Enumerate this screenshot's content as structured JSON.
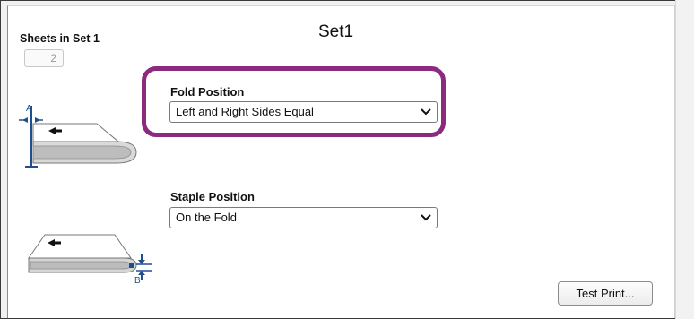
{
  "header": {
    "set_title": "Set1"
  },
  "sheets": {
    "label": "Sheets in Set 1",
    "value": "2"
  },
  "fold": {
    "label": "Fold Position",
    "selected": "Left and Right Sides Equal"
  },
  "staple": {
    "label": "Staple Position",
    "selected": "On the Fold"
  },
  "illustrations": {
    "fold_marker": "A",
    "staple_marker": "B"
  },
  "actions": {
    "test_print": "Test Print..."
  },
  "colors": {
    "highlight": "#8b2a7e",
    "accent_blue": "#1f4e8c"
  }
}
